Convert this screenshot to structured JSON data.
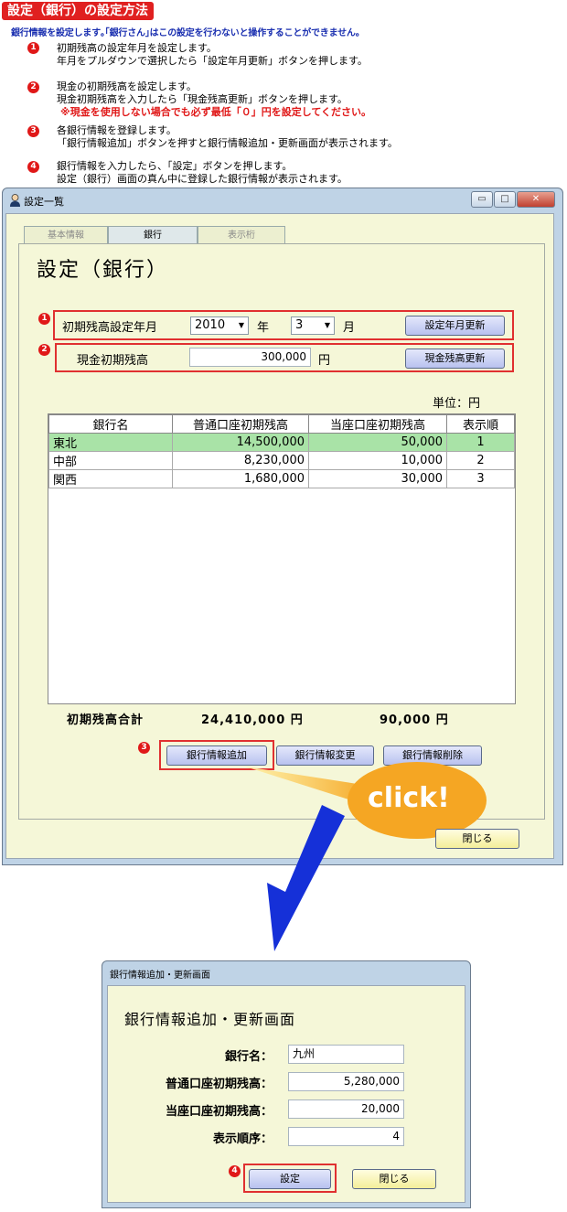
{
  "doc": {
    "title": "設定（銀行）の設定方法",
    "intro": "銀行情報を設定します｡｢銀行さん｣はこの設定を行わないと操作することができません。",
    "steps": [
      {
        "num": "1",
        "lines": [
          "初期残高の設定年月を設定します。",
          "年月をプルダウンで選択したら「設定年月更新」ボタンを押します。"
        ],
        "note": ""
      },
      {
        "num": "2",
        "lines": [
          "現金の初期残高を設定します。",
          "現金初期残高を入力したら「現金残高更新」ボタンを押します。"
        ],
        "note": "※現金を使用しない場合でも必ず最低「０」円を設定してください。"
      },
      {
        "num": "3",
        "lines": [
          "各銀行情報を登録します。",
          "「銀行情報追加」ボタンを押すと銀行情報追加・更新画面が表示されます。"
        ],
        "note": ""
      },
      {
        "num": "4",
        "lines": [
          "銀行情報を入力したら、「設定」ボタンを押します。",
          "設定（銀行）画面の真ん中に登録した銀行情報が表示されます。"
        ],
        "note": ""
      }
    ]
  },
  "window": {
    "title": "設定一覧",
    "controls": {
      "minimize": "▭",
      "restore": "□",
      "close": "✕"
    },
    "tabs": [
      {
        "label": "基本情報",
        "active": false
      },
      {
        "label": "銀行",
        "active": true
      },
      {
        "label": "表示桁",
        "active": false
      }
    ],
    "heading": "設定（銀行）",
    "period": {
      "badge": "1",
      "label": "初期残高設定年月",
      "year_value": "2010",
      "year_unit": "年",
      "month_value": "3",
      "month_unit": "月",
      "button": "設定年月更新"
    },
    "cash": {
      "badge": "2",
      "label": "現金初期残高",
      "value": "300,000",
      "unit": "円",
      "button": "現金残高更新"
    },
    "unit_label": "単位：円",
    "table": {
      "headers": [
        "銀行名",
        "普通口座初期残高",
        "当座口座初期残高",
        "表示順"
      ],
      "rows": [
        {
          "name": "東北",
          "savings": "14,500,000",
          "checking": "50,000",
          "order": "1",
          "selected": true
        },
        {
          "name": "中部",
          "savings": "8,230,000",
          "checking": "10,000",
          "order": "2",
          "selected": false
        },
        {
          "name": "関西",
          "savings": "1,680,000",
          "checking": "30,000",
          "order": "3",
          "selected": false
        }
      ]
    },
    "totals": {
      "label": "初期残高合計",
      "savings": "24,410,000 円",
      "checking": "90,000 円"
    },
    "add_badge": "3",
    "buttons": {
      "add": "銀行情報追加",
      "edit": "銀行情報変更",
      "delete": "銀行情報削除",
      "close": "閉じる"
    },
    "click_label": "click!"
  },
  "dialog": {
    "title": "銀行情報追加・更新画面",
    "heading": "銀行情報追加・更新画面",
    "fields": [
      {
        "label": "銀行名：",
        "value": "九州"
      },
      {
        "label": "普通口座初期残高：",
        "value": "5,280,000"
      },
      {
        "label": "当座口座初期残高：",
        "value": "20,000"
      },
      {
        "label": "表示順序：",
        "value": "4"
      }
    ],
    "badge": "4",
    "buttons": {
      "ok": "設定",
      "close": "閉じる"
    }
  },
  "colors": {
    "accent_red": "#e01818",
    "title_blue": "#1a2fb0",
    "selected_row": "#a9e3a7",
    "client_bg": "#f5f7d8"
  }
}
